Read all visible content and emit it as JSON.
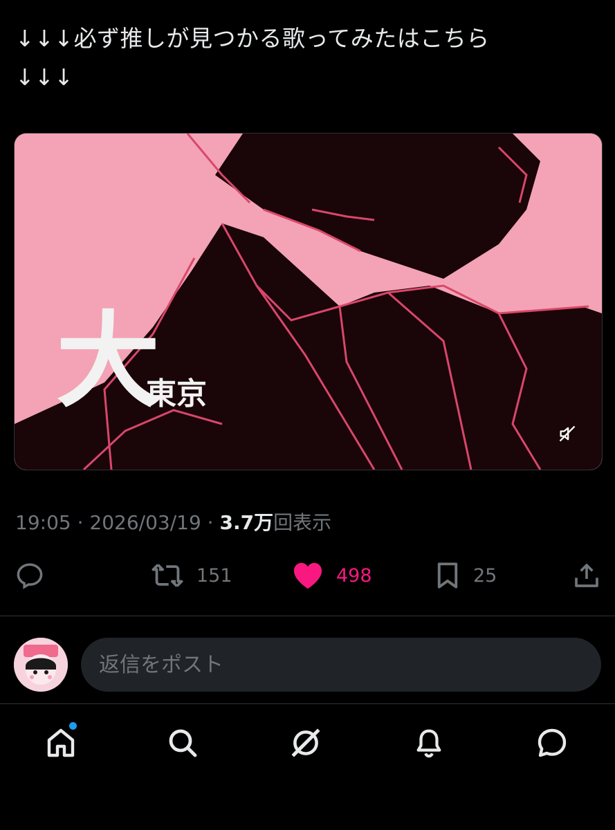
{
  "tweet": {
    "text": "↓↓↓必ず推しが見つかる歌ってみたはこちら\n↓↓↓",
    "media": {
      "overlay_text_large": "大",
      "overlay_text_small": "東京",
      "mute_icon": "speaker-muted-icon"
    },
    "timestamp": "19:05 · 2026/03/19 · ",
    "views_count": "3.7万",
    "views_label": "回表示"
  },
  "actions": {
    "reply_icon": "reply-icon",
    "retweet_icon": "retweet-icon",
    "retweet_count": "151",
    "like_icon": "heart-icon",
    "like_count": "498",
    "bookmark_icon": "bookmark-icon",
    "bookmark_count": "25",
    "share_icon": "share-icon"
  },
  "reply": {
    "placeholder": "返信をポスト"
  },
  "nav": {
    "items": [
      "home-icon",
      "search-icon",
      "grok-icon",
      "notifications-icon",
      "messages-icon"
    ],
    "home_has_badge": true
  },
  "colors": {
    "background": "#000000",
    "text": "#e7e9ea",
    "muted": "#71767b",
    "like": "#f91880",
    "accent": "#1d9bf0",
    "media_pink": "#f3a3b5"
  }
}
